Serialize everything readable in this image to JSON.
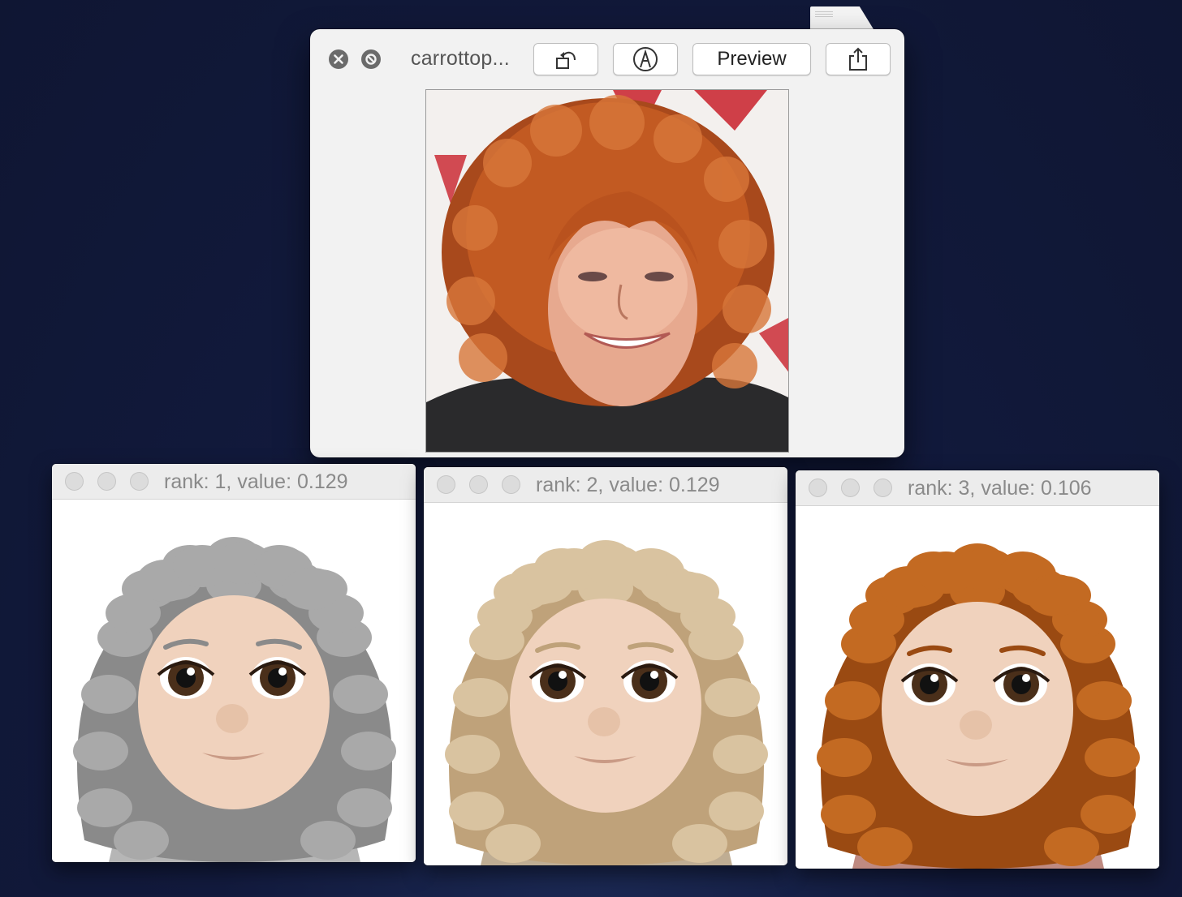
{
  "quicklook": {
    "title": "carrottop...",
    "preview_label": "Preview",
    "buttons": {
      "close": "close-icon",
      "fullscreen_block": "block-icon",
      "rotate": "rotate-left-icon",
      "markup": "markup-pen-icon",
      "share": "share-icon"
    }
  },
  "results": [
    {
      "title": "rank: 1, value: 0.129",
      "hair_color": "#a9a9a9",
      "hair_shadow": "#8a8a8a",
      "shirt": "#7a7a7a"
    },
    {
      "title": "rank: 2, value: 0.129",
      "hair_color": "#d9c3a0",
      "hair_shadow": "#bfa27a",
      "shirt": "#8a6a3a"
    },
    {
      "title": "rank: 3, value: 0.106",
      "hair_color": "#c36a22",
      "hair_shadow": "#9a4a12",
      "shirt": "#8a2a1a"
    }
  ],
  "colors": {
    "desktop": "#121a3d",
    "skin": "#f0d2bd"
  }
}
